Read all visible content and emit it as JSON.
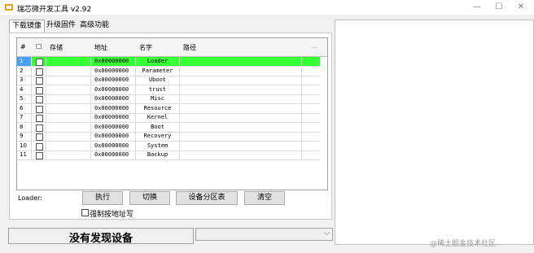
{
  "window": {
    "title": "瑞芯微开发工具 v2.92",
    "icon": "rockchip-app-icon",
    "min": "—",
    "max": "☐",
    "close": "✕"
  },
  "tabs": [
    {
      "label": "下载镜像",
      "active": true
    },
    {
      "label": "升级固件",
      "active": false
    },
    {
      "label": "高级功能",
      "active": false
    }
  ],
  "grid": {
    "headers": {
      "index": "#",
      "check": "☐",
      "storage": "存储",
      "address": "地址",
      "name": "名字",
      "path": "路径",
      "more": "..."
    },
    "rows": [
      {
        "index": "1",
        "address": "0x00000000",
        "name": "Loader",
        "selected": true
      },
      {
        "index": "2",
        "address": "0x00000000",
        "name": "Parameter"
      },
      {
        "index": "3",
        "address": "0x00000000",
        "name": "Uboot"
      },
      {
        "index": "4",
        "address": "0x00000000",
        "name": "trust"
      },
      {
        "index": "5",
        "address": "0x00000000",
        "name": "Misc"
      },
      {
        "index": "6",
        "address": "0x00000000",
        "name": "Resource"
      },
      {
        "index": "7",
        "address": "0x00000000",
        "name": "Kernel"
      },
      {
        "index": "8",
        "address": "0x00000000",
        "name": "Boot"
      },
      {
        "index": "9",
        "address": "0x00000000",
        "name": "Recovery"
      },
      {
        "index": "10",
        "address": "0x00000000",
        "name": "System"
      },
      {
        "index": "11",
        "address": "0x00000000",
        "name": "Backup"
      }
    ]
  },
  "loader_label": "Loader:",
  "buttons": {
    "exec": "执行",
    "switch": "切换",
    "partition": "设备分区表",
    "clear": "清空"
  },
  "force_addr": {
    "label": "强制按地址写",
    "checked": false
  },
  "status": {
    "text": "没有发现设备"
  },
  "combo": {
    "value": ""
  },
  "watermark": "@稀土掘金技术社区",
  "colors": {
    "selected_row": "#33ff33",
    "selected_index": "#4aa0ff"
  }
}
